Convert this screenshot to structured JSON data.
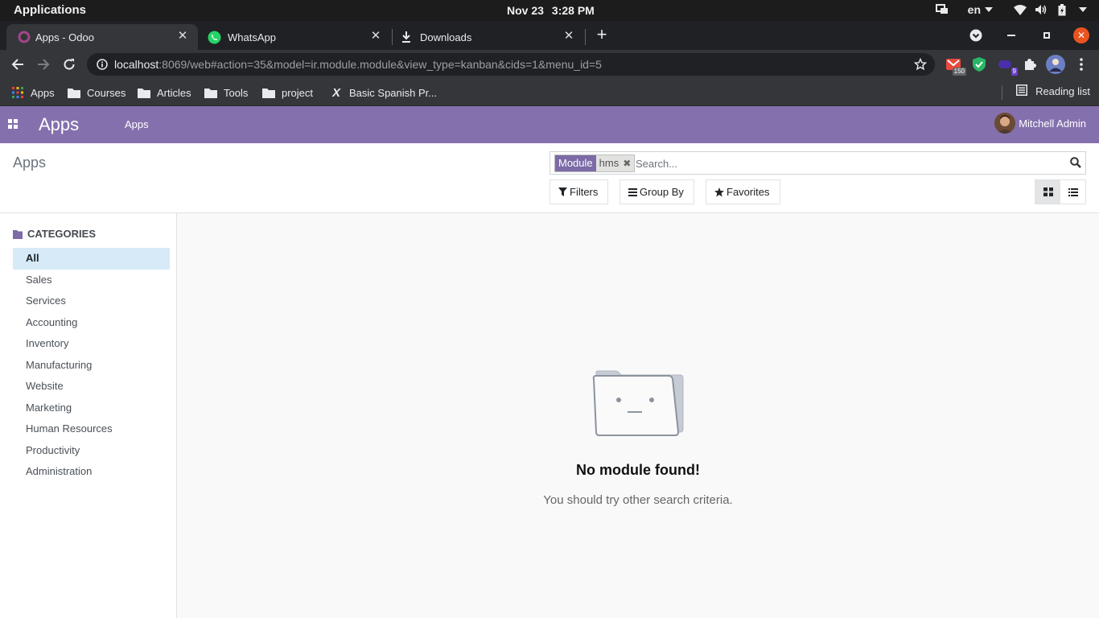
{
  "os": {
    "apps_label": "Applications",
    "date": "Nov 23",
    "time": "3:28 PM",
    "lang": "en"
  },
  "browser": {
    "tabs": [
      {
        "title": "Apps - Odoo",
        "active": true
      },
      {
        "title": "WhatsApp",
        "active": false
      },
      {
        "title": "Downloads",
        "active": false
      }
    ],
    "url_host": "localhost",
    "url_rest": ":8069/web#action=35&model=ir.module.module&view_type=kanban&cids=1&menu_id=5",
    "ext_badge_mail": "150",
    "ext_badge_purple": "9",
    "bookmarks": [
      {
        "label": "Apps",
        "icon": "apps-grid-icon"
      },
      {
        "label": "Courses",
        "icon": "folder-icon"
      },
      {
        "label": "Articles",
        "icon": "folder-icon"
      },
      {
        "label": "Tools",
        "icon": "folder-icon"
      },
      {
        "label": "project",
        "icon": "folder-icon"
      },
      {
        "label": "Basic Spanish Pr...",
        "icon": "x-icon"
      }
    ],
    "reading_list": "Reading list"
  },
  "odoo": {
    "brand": "Apps",
    "menu": "Apps",
    "user": "Mitchell Admin",
    "accent": "#8570ae",
    "control_panel": {
      "title": "Apps",
      "facet_label": "Module",
      "facet_value": "hms",
      "search_placeholder": "Search...",
      "filters": "Filters",
      "group_by": "Group By",
      "favorites": "Favorites"
    },
    "side_panel": {
      "header": "CATEGORIES",
      "categories": [
        "All",
        "Sales",
        "Services",
        "Accounting",
        "Inventory",
        "Manufacturing",
        "Website",
        "Marketing",
        "Human Resources",
        "Productivity",
        "Administration"
      ],
      "selected": "All"
    },
    "empty": {
      "title": "No module found!",
      "subtitle": "You should try other search criteria."
    }
  }
}
